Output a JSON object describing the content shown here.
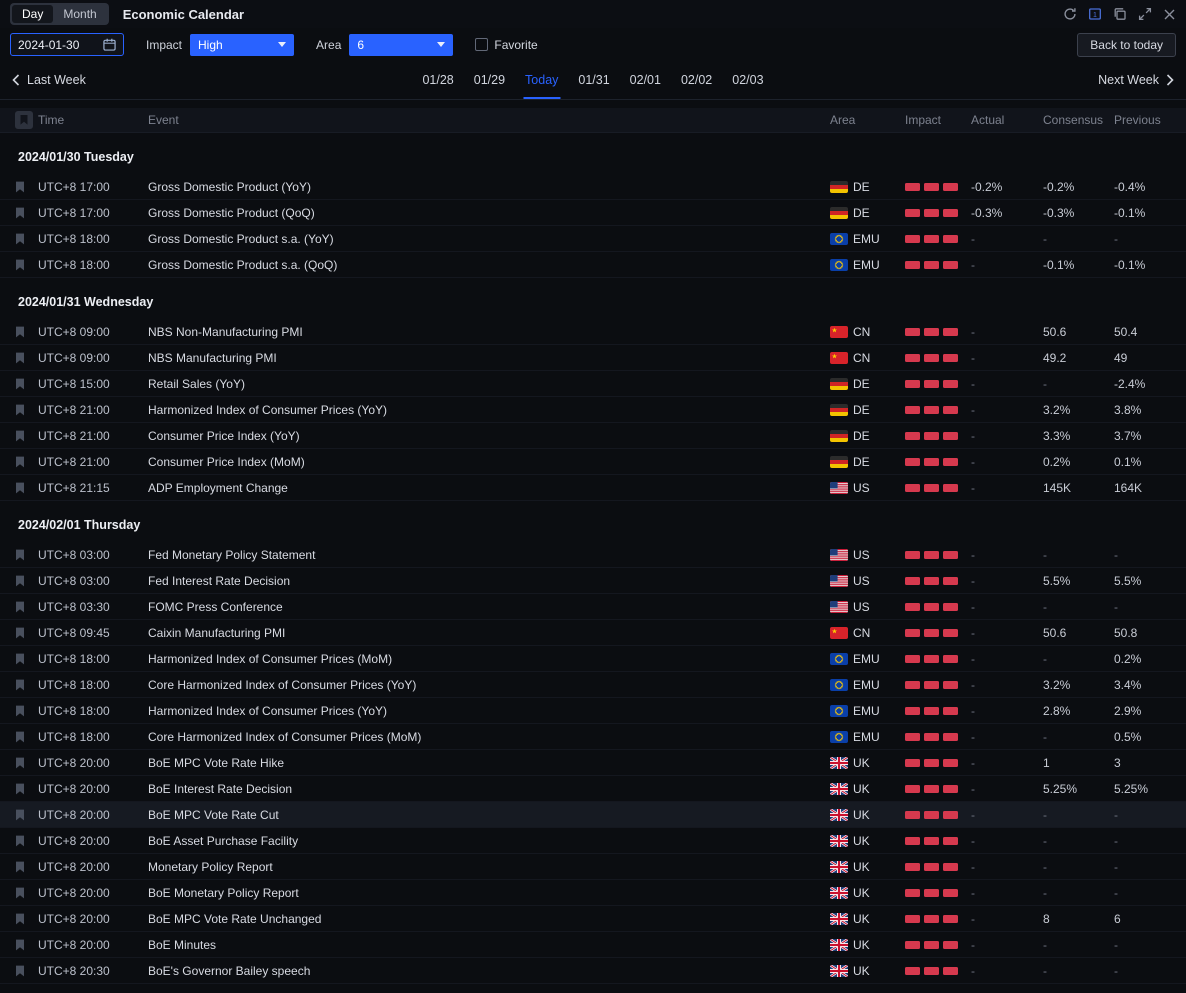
{
  "colors": {
    "accent_blue": "#2962ff",
    "impact_red": "#d6394e"
  },
  "titlebar": {
    "day_label": "Day",
    "month_label": "Month",
    "title": "Economic Calendar"
  },
  "filters": {
    "date_value": "2024-01-30",
    "impact_label": "Impact",
    "impact_value": "High",
    "area_label": "Area",
    "area_value": "6",
    "favorite_label": "Favorite",
    "back_to_today_label": "Back to today"
  },
  "week_nav": {
    "last_week_label": "Last Week",
    "next_week_label": "Next Week",
    "days": [
      {
        "label": "01/28",
        "active": false
      },
      {
        "label": "01/29",
        "active": false
      },
      {
        "label": "Today",
        "active": true
      },
      {
        "label": "01/31",
        "active": false
      },
      {
        "label": "02/01",
        "active": false
      },
      {
        "label": "02/02",
        "active": false
      },
      {
        "label": "02/03",
        "active": false
      }
    ]
  },
  "table": {
    "columns": [
      "Time",
      "Event",
      "Area",
      "Impact",
      "Actual",
      "Consensus",
      "Previous"
    ],
    "sections": [
      {
        "date_header": "2024/01/30 Tuesday",
        "rows": [
          {
            "time": "UTC+8 17:00",
            "event": "Gross Domestic Product (YoY)",
            "area": "DE",
            "impact": "high",
            "actual": "-0.2%",
            "consensus": "-0.2%",
            "previous": "-0.4%"
          },
          {
            "time": "UTC+8 17:00",
            "event": "Gross Domestic Product (QoQ)",
            "area": "DE",
            "impact": "high",
            "actual": "-0.3%",
            "consensus": "-0.3%",
            "previous": "-0.1%"
          },
          {
            "time": "UTC+8 18:00",
            "event": "Gross Domestic Product s.a. (YoY)",
            "area": "EMU",
            "impact": "high",
            "actual": "-",
            "consensus": "-",
            "previous": "-"
          },
          {
            "time": "UTC+8 18:00",
            "event": "Gross Domestic Product s.a. (QoQ)",
            "area": "EMU",
            "impact": "high",
            "actual": "-",
            "consensus": "-0.1%",
            "previous": "-0.1%"
          }
        ]
      },
      {
        "date_header": "2024/01/31 Wednesday",
        "rows": [
          {
            "time": "UTC+8 09:00",
            "event": "NBS Non-Manufacturing PMI",
            "area": "CN",
            "impact": "high",
            "actual": "-",
            "consensus": "50.6",
            "previous": "50.4"
          },
          {
            "time": "UTC+8 09:00",
            "event": "NBS Manufacturing PMI",
            "area": "CN",
            "impact": "high",
            "actual": "-",
            "consensus": "49.2",
            "previous": "49"
          },
          {
            "time": "UTC+8 15:00",
            "event": "Retail Sales (YoY)",
            "area": "DE",
            "impact": "high",
            "actual": "-",
            "consensus": "-",
            "previous": "-2.4%"
          },
          {
            "time": "UTC+8 21:00",
            "event": "Harmonized Index of Consumer Prices (YoY)",
            "area": "DE",
            "impact": "high",
            "actual": "-",
            "consensus": "3.2%",
            "previous": "3.8%"
          },
          {
            "time": "UTC+8 21:00",
            "event": "Consumer Price Index (YoY)",
            "area": "DE",
            "impact": "high",
            "actual": "-",
            "consensus": "3.3%",
            "previous": "3.7%"
          },
          {
            "time": "UTC+8 21:00",
            "event": "Consumer Price Index (MoM)",
            "area": "DE",
            "impact": "high",
            "actual": "-",
            "consensus": "0.2%",
            "previous": "0.1%"
          },
          {
            "time": "UTC+8 21:15",
            "event": "ADP Employment Change",
            "area": "US",
            "impact": "high",
            "actual": "-",
            "consensus": "145K",
            "previous": "164K"
          }
        ]
      },
      {
        "date_header": "2024/02/01 Thursday",
        "rows": [
          {
            "time": "UTC+8 03:00",
            "event": "Fed Monetary Policy Statement",
            "area": "US",
            "impact": "high",
            "actual": "-",
            "consensus": "-",
            "previous": "-"
          },
          {
            "time": "UTC+8 03:00",
            "event": "Fed Interest Rate Decision",
            "area": "US",
            "impact": "high",
            "actual": "-",
            "consensus": "5.5%",
            "previous": "5.5%"
          },
          {
            "time": "UTC+8 03:30",
            "event": "FOMC Press Conference",
            "area": "US",
            "impact": "high",
            "actual": "-",
            "consensus": "-",
            "previous": "-"
          },
          {
            "time": "UTC+8 09:45",
            "event": "Caixin Manufacturing PMI",
            "area": "CN",
            "impact": "high",
            "actual": "-",
            "consensus": "50.6",
            "previous": "50.8"
          },
          {
            "time": "UTC+8 18:00",
            "event": "Harmonized Index of Consumer Prices (MoM)",
            "area": "EMU",
            "impact": "high",
            "actual": "-",
            "consensus": "-",
            "previous": "0.2%"
          },
          {
            "time": "UTC+8 18:00",
            "event": "Core Harmonized Index of Consumer Prices (YoY)",
            "area": "EMU",
            "impact": "high",
            "actual": "-",
            "consensus": "3.2%",
            "previous": "3.4%"
          },
          {
            "time": "UTC+8 18:00",
            "event": "Harmonized Index of Consumer Prices (YoY)",
            "area": "EMU",
            "impact": "high",
            "actual": "-",
            "consensus": "2.8%",
            "previous": "2.9%"
          },
          {
            "time": "UTC+8 18:00",
            "event": "Core Harmonized Index of Consumer Prices (MoM)",
            "area": "EMU",
            "impact": "high",
            "actual": "-",
            "consensus": "-",
            "previous": "0.5%"
          },
          {
            "time": "UTC+8 20:00",
            "event": "BoE MPC Vote Rate Hike",
            "area": "UK",
            "impact": "high",
            "actual": "-",
            "consensus": "1",
            "previous": "3"
          },
          {
            "time": "UTC+8 20:00",
            "event": "BoE Interest Rate Decision",
            "area": "UK",
            "impact": "high",
            "actual": "-",
            "consensus": "5.25%",
            "previous": "5.25%"
          },
          {
            "time": "UTC+8 20:00",
            "event": "BoE MPC Vote Rate Cut",
            "area": "UK",
            "impact": "high",
            "actual": "-",
            "consensus": "-",
            "previous": "-",
            "highlighted": true
          },
          {
            "time": "UTC+8 20:00",
            "event": "BoE Asset Purchase Facility",
            "area": "UK",
            "impact": "high",
            "actual": "-",
            "consensus": "-",
            "previous": "-"
          },
          {
            "time": "UTC+8 20:00",
            "event": "Monetary Policy Report",
            "area": "UK",
            "impact": "high",
            "actual": "-",
            "consensus": "-",
            "previous": "-"
          },
          {
            "time": "UTC+8 20:00",
            "event": "BoE Monetary Policy Report",
            "area": "UK",
            "impact": "high",
            "actual": "-",
            "consensus": "-",
            "previous": "-"
          },
          {
            "time": "UTC+8 20:00",
            "event": "BoE MPC Vote Rate Unchanged",
            "area": "UK",
            "impact": "high",
            "actual": "-",
            "consensus": "8",
            "previous": "6"
          },
          {
            "time": "UTC+8 20:00",
            "event": "BoE Minutes",
            "area": "UK",
            "impact": "high",
            "actual": "-",
            "consensus": "-",
            "previous": "-"
          },
          {
            "time": "UTC+8 20:30",
            "event": "BoE's Governor Bailey speech",
            "area": "UK",
            "impact": "high",
            "actual": "-",
            "consensus": "-",
            "previous": "-"
          }
        ]
      }
    ]
  }
}
